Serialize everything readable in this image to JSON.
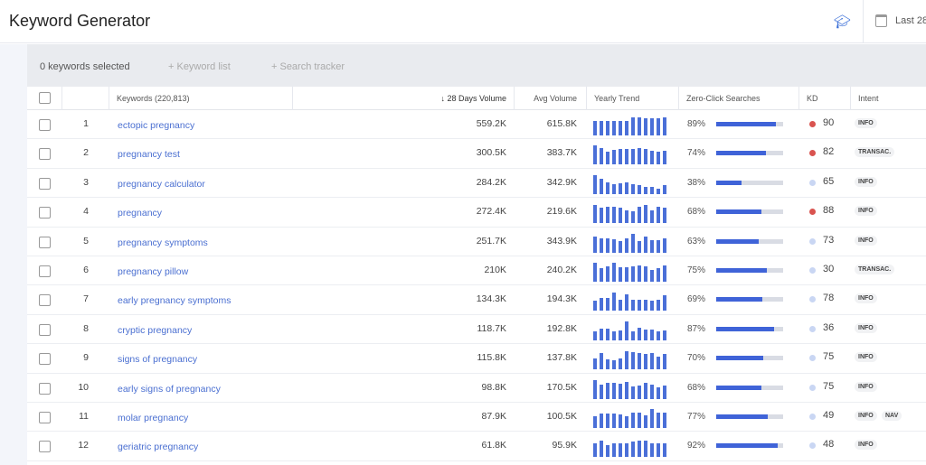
{
  "header": {
    "title": "Keyword Generator",
    "date_label": "Last 28"
  },
  "toolbar": {
    "selected": "0 keywords selected",
    "keyword_list": "+ Keyword list",
    "search_tracker": "+ Search tracker"
  },
  "columns": {
    "keywords": "Keywords (220,813)",
    "days28": "↓ 28 Days Volume",
    "avg": "Avg Volume",
    "trend": "Yearly Trend",
    "zero": "Zero-Click Searches",
    "kd": "KD",
    "intent": "Intent"
  },
  "colors": {
    "accent": "#3f63d8",
    "kd_high": "#d9534f",
    "kd_low": "#c9d6f3"
  },
  "rows": [
    {
      "n": "1",
      "kw": "ectopic pregnancy",
      "v28": "559.2K",
      "avg": "615.8K",
      "zc": 89,
      "kd": 90,
      "intent": [
        "INFO"
      ],
      "trend": [
        0.75,
        0.75,
        0.75,
        0.75,
        0.75,
        0.75,
        0.95,
        0.95,
        0.9,
        0.9,
        0.9,
        0.95
      ]
    },
    {
      "n": "2",
      "kw": "pregnancy test",
      "v28": "300.5K",
      "avg": "383.7K",
      "zc": 74,
      "kd": 82,
      "intent": [
        "TRANSAC."
      ],
      "trend": [
        1,
        0.9,
        0.7,
        0.8,
        0.85,
        0.85,
        0.85,
        0.9,
        0.85,
        0.75,
        0.7,
        0.75
      ]
    },
    {
      "n": "3",
      "kw": "pregnancy calculator",
      "v28": "284.2K",
      "avg": "342.9K",
      "zc": 38,
      "kd": 65,
      "intent": [
        "INFO"
      ],
      "trend": [
        1,
        0.8,
        0.6,
        0.5,
        0.55,
        0.6,
        0.5,
        0.45,
        0.35,
        0.35,
        0.3,
        0.45
      ]
    },
    {
      "n": "4",
      "kw": "pregnancy",
      "v28": "272.4K",
      "avg": "219.6K",
      "zc": 68,
      "kd": 88,
      "intent": [
        "INFO"
      ],
      "trend": [
        0.95,
        0.8,
        0.85,
        0.85,
        0.8,
        0.7,
        0.65,
        0.85,
        0.95,
        0.7,
        0.85,
        0.8
      ]
    },
    {
      "n": "5",
      "kw": "pregnancy symptoms",
      "v28": "251.7K",
      "avg": "343.9K",
      "zc": 63,
      "kd": 73,
      "intent": [
        "INFO"
      ],
      "trend": [
        0.85,
        0.75,
        0.75,
        0.7,
        0.6,
        0.75,
        1,
        0.6,
        0.85,
        0.65,
        0.65,
        0.75
      ]
    },
    {
      "n": "6",
      "kw": "pregnancy pillow",
      "v28": "210K",
      "avg": "240.2K",
      "zc": 75,
      "kd": 30,
      "intent": [
        "TRANSAC."
      ],
      "trend": [
        1,
        0.7,
        0.8,
        1,
        0.75,
        0.75,
        0.8,
        0.85,
        0.8,
        0.6,
        0.7,
        0.85
      ]
    },
    {
      "n": "7",
      "kw": "early pregnancy symptoms",
      "v28": "134.3K",
      "avg": "194.3K",
      "zc": 69,
      "kd": 78,
      "intent": [
        "INFO"
      ],
      "trend": [
        0.55,
        0.7,
        0.7,
        0.95,
        0.6,
        0.9,
        0.6,
        0.6,
        0.6,
        0.55,
        0.6,
        0.85
      ]
    },
    {
      "n": "8",
      "kw": "cryptic pregnancy",
      "v28": "118.7K",
      "avg": "192.8K",
      "zc": 87,
      "kd": 36,
      "intent": [
        "INFO"
      ],
      "trend": [
        0.45,
        0.6,
        0.6,
        0.45,
        0.5,
        1,
        0.45,
        0.65,
        0.55,
        0.55,
        0.45,
        0.5
      ]
    },
    {
      "n": "9",
      "kw": "signs of pregnancy",
      "v28": "115.8K",
      "avg": "137.8K",
      "zc": 70,
      "kd": 75,
      "intent": [
        "INFO"
      ],
      "trend": [
        0.6,
        0.85,
        0.55,
        0.5,
        0.6,
        0.95,
        0.9,
        0.85,
        0.8,
        0.85,
        0.7,
        0.8
      ]
    },
    {
      "n": "10",
      "kw": "early signs of pregnancy",
      "v28": "98.8K",
      "avg": "170.5K",
      "zc": 68,
      "kd": 75,
      "intent": [
        "INFO"
      ],
      "trend": [
        1,
        0.75,
        0.85,
        0.85,
        0.8,
        0.9,
        0.65,
        0.7,
        0.85,
        0.75,
        0.6,
        0.7
      ]
    },
    {
      "n": "11",
      "kw": "molar pregnancy",
      "v28": "87.9K",
      "avg": "100.5K",
      "zc": 77,
      "kd": 49,
      "intent": [
        "INFO",
        "NAV"
      ],
      "trend": [
        0.6,
        0.75,
        0.75,
        0.75,
        0.7,
        0.6,
        0.8,
        0.8,
        0.65,
        1,
        0.8,
        0.8
      ]
    },
    {
      "n": "12",
      "kw": "geriatric pregnancy",
      "v28": "61.8K",
      "avg": "95.9K",
      "zc": 92,
      "kd": 48,
      "intent": [
        "INFO"
      ],
      "trend": [
        0.75,
        0.9,
        0.65,
        0.75,
        0.75,
        0.75,
        0.85,
        0.9,
        0.9,
        0.75,
        0.75,
        0.75
      ]
    }
  ]
}
